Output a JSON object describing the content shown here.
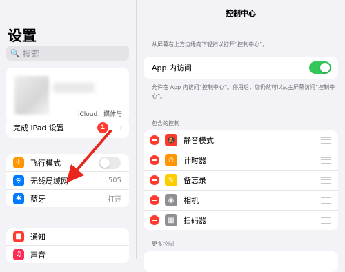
{
  "sidebar": {
    "title": "设置",
    "search_placeholder": "搜索",
    "profile_subtitle": "iCloud、媒体与",
    "ipad_setup": {
      "label": "完成 iPad 设置",
      "badge": "1"
    },
    "network_items": [
      {
        "label": "飞行模式",
        "icon": "airplane-icon",
        "color": "#ff9500"
      },
      {
        "label": "无线局域网",
        "icon": "wifi-icon",
        "color": "#007aff",
        "value": "505"
      },
      {
        "label": "蓝牙",
        "icon": "bluetooth-icon",
        "color": "#007aff",
        "value": "打开"
      }
    ],
    "notify_items": [
      {
        "label": "通知",
        "icon": "notification-icon",
        "color": "#ff3b30"
      },
      {
        "label": "声音",
        "icon": "sound-icon",
        "color": "#ff2d55"
      }
    ]
  },
  "main": {
    "title": "控制中心",
    "hint": "从屏幕右上方边缘向下轻扫以打开“控制中心”。",
    "app_access": {
      "label": "App 内访问",
      "on": true
    },
    "app_access_desc": "允许在 App 内访问“控制中心”。停用后，您仍然可以从主屏幕访问“控制中心”。",
    "included_header": "包含的控制",
    "included": [
      {
        "label": "静音模式",
        "icon": "bell-slash-icon",
        "color": "#ff3b30"
      },
      {
        "label": "计时器",
        "icon": "timer-icon",
        "color": "#ff9500"
      },
      {
        "label": "备忘录",
        "icon": "notes-icon",
        "color": "#ffcc00"
      },
      {
        "label": "相机",
        "icon": "camera-icon",
        "color": "#8e8e93"
      },
      {
        "label": "扫码器",
        "icon": "qr-scanner-icon",
        "color": "#8e8e93"
      }
    ],
    "more_header": "更多控制"
  },
  "colors": {
    "accent": "#007aff",
    "toggle_on": "#34c759",
    "destructive": "#ff3b30",
    "annotation": "#e8261e"
  }
}
